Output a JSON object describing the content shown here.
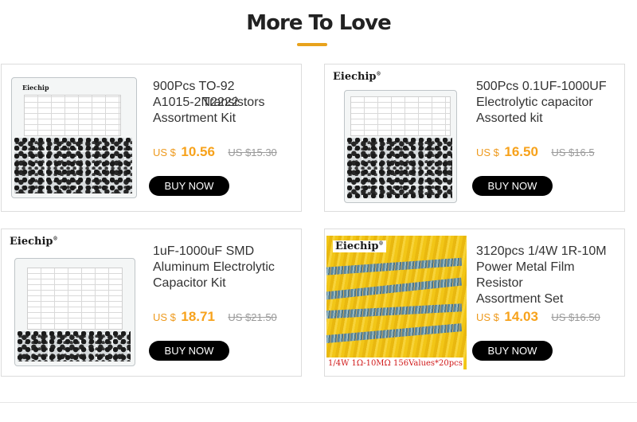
{
  "section": {
    "title": "More To Love",
    "accent_color": "#e8a21c"
  },
  "products": [
    {
      "title_lines": [
        "900Pcs TO-92",
        "A1015-2N2222",
        "Assortment Kit"
      ],
      "overlay_text": "Transistors",
      "currency": "US $",
      "price": "10.56",
      "old_price": "US $15.30",
      "button": "BUY NOW",
      "brand": "Eiechip"
    },
    {
      "title_lines": [
        "500Pcs 0.1UF-1000UF",
        "Electrolytic capacitor",
        "Assorted kit"
      ],
      "currency": "US $",
      "price": "16.50",
      "old_price": "US $16.5",
      "button": "BUY NOW",
      "brand": "Eiechip"
    },
    {
      "title_lines": [
        "1uF-1000uF SMD",
        "Aluminum Electrolytic",
        "Capacitor Kit"
      ],
      "currency": "US $",
      "price": "18.71",
      "old_price": "US $21.50",
      "button": "BUY NOW",
      "brand": "Eiechip"
    },
    {
      "title_lines": [
        "3120pcs 1/4W 1R-10M",
        "Power Metal Film Resistor",
        "Assortment Set"
      ],
      "currency": "US $",
      "price": "14.03",
      "old_price": "US $16.50",
      "button": "BUY NOW",
      "brand": "Eiechip",
      "image_caption": "1/4W 1Ω-10MΩ 156Values*20pcs"
    }
  ],
  "colors": {
    "price": "#f7a21b",
    "button_bg": "#000000",
    "caption": "#d11a1a"
  }
}
